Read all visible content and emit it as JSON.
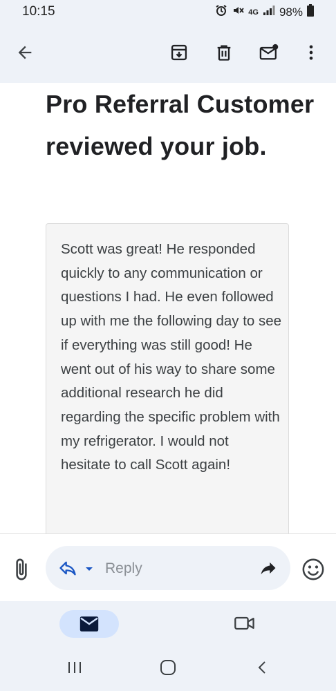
{
  "status_bar": {
    "time": "10:15",
    "network": "4G",
    "battery": "98%",
    "icons": [
      "alarm-icon",
      "mute-icon",
      "signal-icon",
      "battery-icon"
    ]
  },
  "app_bar": {
    "icons": [
      "back-arrow-icon",
      "archive-icon",
      "trash-icon",
      "mark-unread-icon",
      "more-vert-icon"
    ]
  },
  "email": {
    "title": "Pro Referral Customer reviewed your job.",
    "review": "Scott was great! He responded quickly to any communication or questions I had. He even followed up with me the following day to see if everything was still good! He went out of his way to share some additional research he did regarding the specific problem with my refrigerator. I would not hesitate to call Scott again!"
  },
  "reply_bar": {
    "reply_label": "Reply",
    "icons": [
      "attachment-icon",
      "reply-icon",
      "dropdown-icon",
      "forward-icon",
      "emoji-icon"
    ]
  },
  "bottom_nav": {
    "items": [
      "mail-icon",
      "video-meet-icon"
    ],
    "active": "mail-icon"
  },
  "colors": {
    "app_background": "#eef2f8",
    "accent": "#1a56c4",
    "active_nav_pill": "#d3e3fd"
  }
}
